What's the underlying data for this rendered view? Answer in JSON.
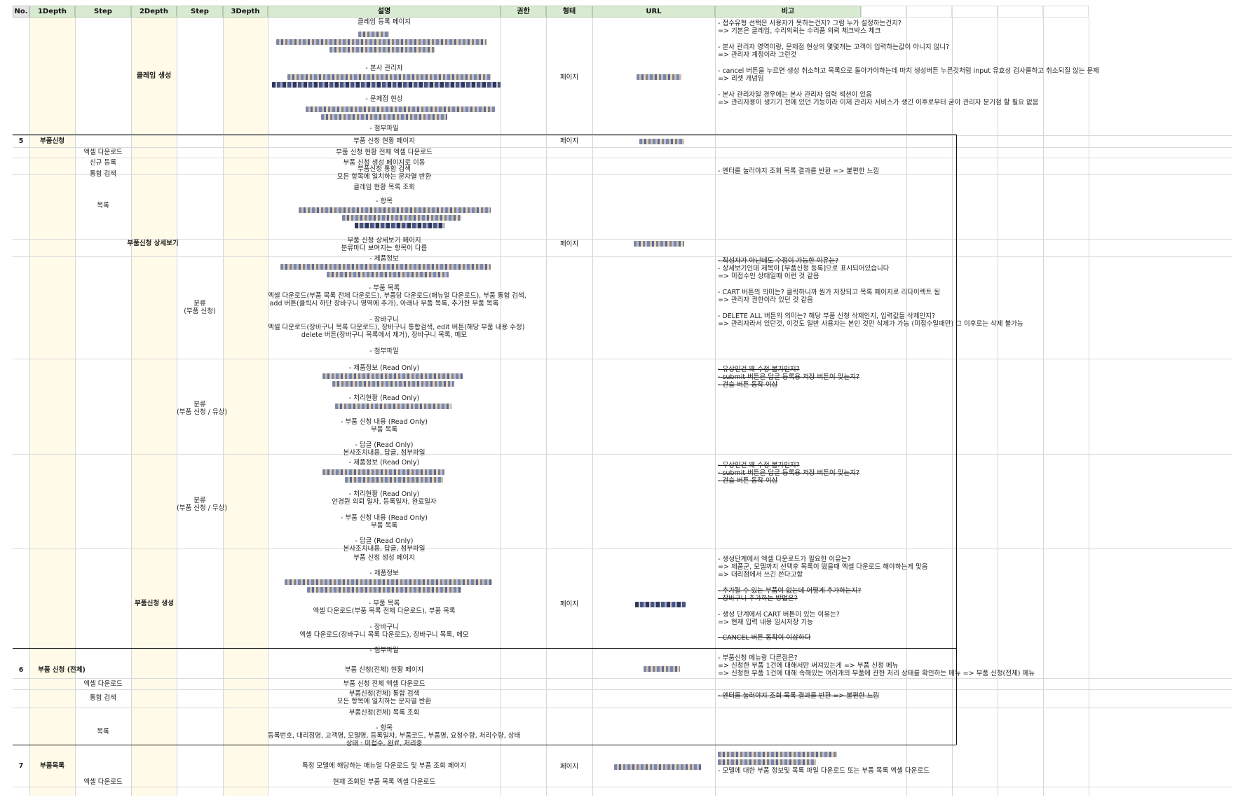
{
  "headers": {
    "no": "No.",
    "depth1": "1Depth",
    "step1": "Step",
    "depth2": "2Depth",
    "step2": "Step",
    "depth3": "3Depth",
    "desc": "설명",
    "auth": "권한",
    "form": "형태",
    "url": "URL",
    "remarks": "비고"
  },
  "rows": {
    "r0": {
      "depth2": "클레임 생성",
      "desc1": "클레임 등록 페이지",
      "desc2": "- 본사 관리자",
      "desc3": "- 문제점 현상",
      "desc4": "- 첨부파일",
      "form": "페이지",
      "rem1": "- 접수유형 선택은 사용자가 못하는건지? 그럼 누가 설정하는건지?",
      "rem2": "=> 기본은 클레임, 수리의뢰는 수리품 의뢰 체크박스 체크",
      "rem3": "- 본사 관리자 영역이랑, 문제점 현상의 몇몇개는 고객이 입력하는값이 아니지 않니?",
      "rem4": "=> 관리자 계정이라 그런것",
      "rem5": "- cancel 버튼을 누르면 생성 취소하고 목록으로 돌아가야하는데 마치 생성버튼 누른것처럼 input 유효성 검사를하고 취소되질 않는 문제",
      "rem6": "=> 리셋 개념임",
      "rem7": "- 본사 관리자일 경우에는 본사 관리자 입력 섹션이 있음",
      "rem8": "=> 관리자용이 생기기 전에 있던 기능이라 이제 관리자 서비스가 생긴 이후로부터 굳이 관리자 분기점 할 필요 없음"
    },
    "r5": {
      "no": "5",
      "depth1": "부품신청",
      "desc": "부품 신청 현황 페이지",
      "form": "페이지"
    },
    "r5a": {
      "step1": "엑셀 다운로드",
      "desc": "부품 신청 현황 전체 엑셀 다운로드"
    },
    "r5b": {
      "step1": "신규 등록",
      "desc": "부품 신청 생성 페이지로 이동"
    },
    "r5c": {
      "step1": "통합 검색",
      "desc1": "부품신청 통합 검색",
      "desc2": "모든 항목에 일치하는 문자열 반환",
      "rem": "- 엔터를 눌러야지 조회 목록 결과를 반환 => 불편한 느낌"
    },
    "r5d": {
      "step1": "목록",
      "desc1": "클레임 현황 목록 조회",
      "desc2": "- 항목"
    },
    "r5e": {
      "depth2": "부품신청 상세보기",
      "desc1": "부품 신청 상세보기 페이지",
      "desc2": "분류마다 보여지는 항목이 다름",
      "form": "페이지"
    },
    "r5f": {
      "step2": "분류\n(부품 신청)",
      "d1": "- 제품정보",
      "d2": "- 부품 목록",
      "d3": "엑셀 다운로드(부품 목록 전체 다운로드), 부품당 다운로드(매뉴얼 다운로드), 부품 통합 검색,",
      "d4": "add 버튼(클릭시 하단 장바구니 영역에 추가), 아래나 부품 목록, 추가한 부품 목록",
      "d5": "- 장바구니",
      "d6": "엑셀 다운로드(장바구니 목록 다운로드), 장바구니 통합검색, edit 버튼(해당 부품 내용 수정)",
      "d7": "delete 버튼(장바구니 목록에서 제거), 장바구니 목록, 메모",
      "d8": "- 첨부파일",
      "rem1": "- 작성자가 아닌데도 수정이 가능한 이유는?",
      "rem2": "- 상세보기인데 제목이 [부품신청 등록]으로 표시되어있습니다",
      "rem3": "=> 미접수인 상태일때 이런 것 같음",
      "rem4": "- CART 버튼의 의미는? 클릭하니까 뭔가 저장되고 목록 페이지로 리다이렉트 됨",
      "rem5": "=> 관리자 권한이라 있던 것 같음",
      "rem6": "- DELETE ALL 버튼의 의미는? 해당 부품 신청 삭제인지, 입력값들 삭제인지?",
      "rem7": "=> 관리자라서 있던것, 이것도 일반 사용자는 본인 것만 삭제가 가능 (미접수일때만) 그 이후로는 삭제 불가능"
    },
    "r5g": {
      "step2": "분류\n(부품 신청 / 유상)",
      "d1": "- 제품정보 (Read Only)",
      "d2": "- 처리현황 (Read Only)",
      "d3": "- 부품 신청 내용 (Read Only)",
      "d4": "부품 목록",
      "d5": "- 답글 (Read Only)",
      "d6": "본사조치내용, 답글, 첨부파일",
      "rem1": "- 유상인건 왜 수정 불가인지?",
      "rem2": "- submit 버튼은 답글 등록용 저장 버튼이 맞는지?",
      "rem3": "- 견습 버튼 동작 이상"
    },
    "r5h": {
      "step2": "분류\n(부품 신청 / 무상)",
      "d1": "- 제품정보 (Read Only)",
      "d2": "- 처리현황 (Read Only)",
      "d3": "안경원 의뢰 일자, 등록일자, 완료일자",
      "d4": "- 부품 신청 내용 (Read Only)",
      "d5": "부품 목록",
      "d6": "- 답글 (Read Only)",
      "d7": "본사조치내용, 답글, 첨부파일",
      "rem1": "- 무상인건 왜 수정 불가인지?",
      "rem2": "- submit 버튼은 답글 등록용 저장 버튼이 맞는지?",
      "rem3": "- 견습 버튼 동작 이상"
    },
    "r5i": {
      "depth2": "부품신청 생성",
      "d1": "부품 신청 생성 페이지",
      "d2": "- 제품정보",
      "d3": "- 부품 목록",
      "d4": "엑셀 다운로드(부품 목록 전체 다운로드), 부품 목록",
      "d5": "- 장바구니",
      "d6": "엑셀 다운로드(장바구니 목록 다운로드), 장바구니 목록, 메모",
      "d7": "- 첨부파일",
      "form": "페이지",
      "rem1": "- 생성단계에서 엑셀 다운로드가 필요한 이유는?",
      "rem2": "=> 제품군, 모델까지 선택후 목록이 떴을때 엑셀 다운로드 해야하는게 맞음",
      "rem3": "=> 대리점에서 쓰긴 쓴다고함",
      "rem4": "- 추가될 수 있는 부품이 없는데 어떻게 추가하는지?",
      "rem5": "- 장바구니 추가하는 방법은?",
      "rem6": "- 생성 단계에서 CART 버튼이 있는 이유는?",
      "rem7": "=> 현재 입력 내용 임시저장 기능",
      "rem8": "- CANCEL 버튼 동작이 이상하다"
    },
    "r6": {
      "no": "6",
      "depth1": "부품 신청 (전체)",
      "desc": "부품 신청(전체) 현황 페이지",
      "rem1": "- 부품신청 메뉴랑 다른점은?",
      "rem2": "=> 신청한 부품 1건에 대해서만 써져있는게 => 부품 신청 메뉴",
      "rem3": "=> 신청한 부품 1건에 대해 속해있는 여러개의 부품에 관한 처리 상태를 확인하는 메뉴 => 부품 신청(전체) 메뉴"
    },
    "r6a": {
      "step1": "엑셀 다운로드",
      "desc": "부품 신청 전체 엑셀 다운로드"
    },
    "r6b": {
      "step1": "통합 검색",
      "desc1": "부품신청(전체) 통합 검색",
      "desc2": "모든 항목에 일치하는 문자열 반환",
      "rem": "- 엔터를 눌러야지 조회 목록 결과를 반환 => 불편한 느낌"
    },
    "r6c": {
      "step1": "목록",
      "d1": "부품신청(전체) 목록 조회",
      "d2": "- 항목",
      "d3": "등록번호, 대리점명, 고객명, 모델명, 등록일자, 부품코드, 부품명, 요청수량, 처리수량, 상태",
      "d4": "상태 : 미접수, 완료, 처리중"
    },
    "r7": {
      "no": "7",
      "depth1": "부품목록",
      "desc": "특정 모델에 해당하는 매뉴얼 다운로드 및 부품 조회 페이지",
      "form": "페이지",
      "rem": "- 모델에 대한 부품 정보및 목록 파일 다운로드 또는 부품 목록 엑셀 다운로드"
    },
    "r7a": {
      "step1": "엑셀 다운로드",
      "desc": "현재 조회된 부품 목록 엑셀 다운로드"
    }
  }
}
